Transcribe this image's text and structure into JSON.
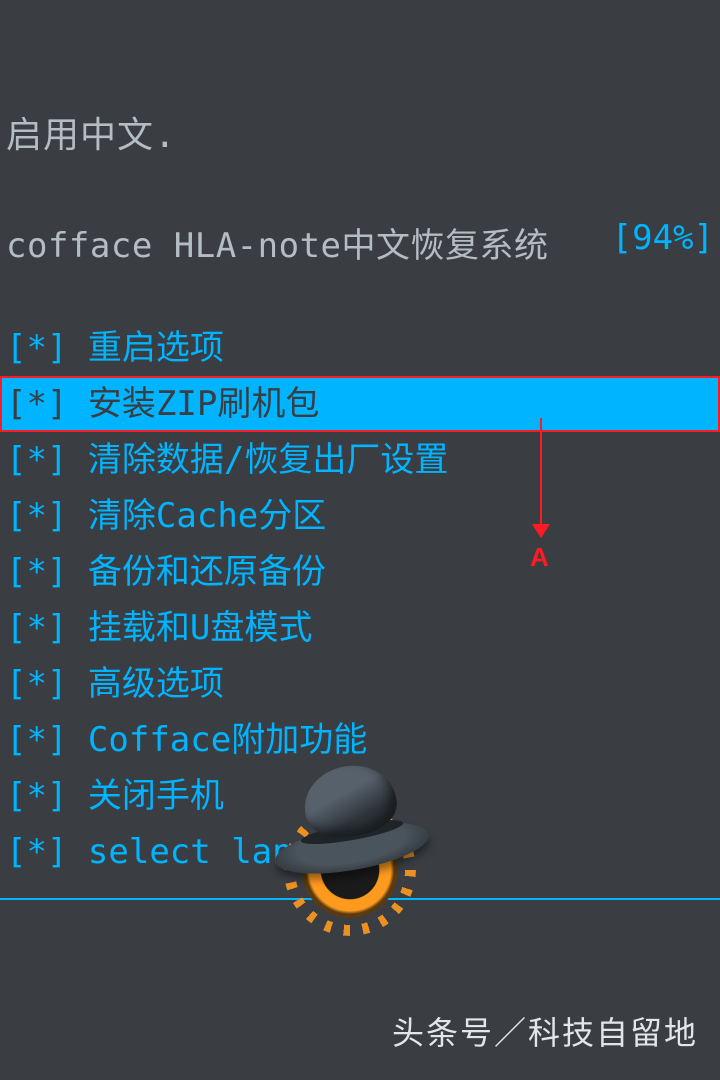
{
  "status_message": "启用中文.",
  "title": "cofface HLA-note中文恢复系统",
  "battery": "[94%]",
  "menu": {
    "bullet": "[*]",
    "items": [
      {
        "label": "重启选项",
        "selected": false
      },
      {
        "label": "安装ZIP刷机包",
        "selected": true
      },
      {
        "label": "清除数据/恢复出厂设置",
        "selected": false
      },
      {
        "label": "清除Cache分区",
        "selected": false
      },
      {
        "label": "备份和还原备份",
        "selected": false
      },
      {
        "label": "挂载和U盘模式",
        "selected": false
      },
      {
        "label": "高级选项",
        "selected": false
      },
      {
        "label": "Cofface附加功能",
        "selected": false
      },
      {
        "label": "关闭手机",
        "selected": false
      },
      {
        "label": "select language",
        "selected": false
      }
    ]
  },
  "annotation": {
    "label": "A"
  },
  "watermark": "头条号／科技自留地"
}
